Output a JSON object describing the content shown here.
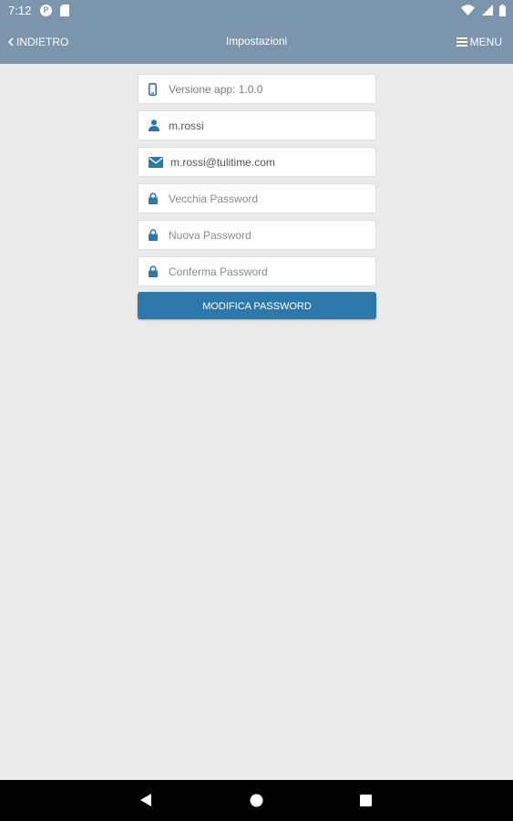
{
  "status_bar": {
    "time": "7:12",
    "icons": [
      "p-notification-icon",
      "sd-card-icon",
      "wifi-icon",
      "signal-icon",
      "battery-icon"
    ]
  },
  "app_bar": {
    "back_label": "INDIETRO",
    "title": "Impostazioni",
    "menu_label": "MENU",
    "background_color": "#7b95ad"
  },
  "form": {
    "version_text": "Versione app: 1.0.0",
    "username": "m.rossi",
    "email": "m.rossi@tulitime.com",
    "old_password_placeholder": "Vecchia Password",
    "new_password_placeholder": "Nuova Password",
    "confirm_password_placeholder": "Conferma Password",
    "submit_label": "MODIFICA PASSWORD",
    "icon_color": "#2d78ab",
    "button_color": "#2d78ab"
  },
  "nav_bar": {
    "icons": [
      "back-triangle-icon",
      "home-circle-icon",
      "recents-square-icon"
    ]
  }
}
